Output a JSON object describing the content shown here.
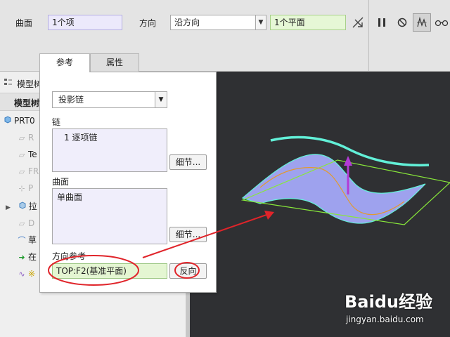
{
  "dashboard": {
    "surface_label": "曲面",
    "surface_value": "1个项",
    "direction_label": "方向",
    "direction_value": "沿方向",
    "plane_value": "1个平面",
    "icons": [
      "flip-arrow-icon",
      "pause-icon",
      "cancel-icon",
      "glasses-icon"
    ]
  },
  "tabs": [
    "参考",
    "属性"
  ],
  "tree": {
    "header1": "模型树",
    "header2": "模型树",
    "items": [
      {
        "label": "PRT0",
        "icon": "part-icon",
        "dim": false
      },
      {
        "label": "R",
        "icon": "datum-plane-icon",
        "dim": true
      },
      {
        "label": "Te",
        "icon": "datum-plane-icon",
        "dim": false
      },
      {
        "label": "FR",
        "icon": "datum-plane-icon",
        "dim": true
      },
      {
        "label": "P",
        "icon": "csys-icon",
        "dim": true
      },
      {
        "label": "拉",
        "icon": "extrude-icon",
        "dim": false
      },
      {
        "label": "D",
        "icon": "datum-plane-icon",
        "dim": true
      },
      {
        "label": "草",
        "icon": "sketch-icon",
        "dim": false
      },
      {
        "label": "在",
        "icon": "insert-arrow-icon",
        "dim": false
      },
      {
        "label": "※",
        "icon": "curve-icon",
        "dim": false
      }
    ]
  },
  "panel": {
    "chain_type": "投影链",
    "chain_label": "链",
    "chain_item": "1 逐项链",
    "detail_button": "细节...",
    "surface_label": "曲面",
    "surface_item": "单曲面",
    "direction_ref_label": "方向参考",
    "direction_ref_value": "TOP:F2(基准平面)",
    "flip_button": "反向"
  },
  "colors": {
    "viewport_bg": "#2f3033",
    "annotation_red": "#e0242a",
    "surface_fill": "#9ea2ee",
    "surface_edge": "#62f0d8",
    "plane_edge": "#88e83a",
    "curve_orange": "#e29a2e",
    "direction_arrow": "#b33bd6"
  },
  "watermark": {
    "brand": "Baidu经验",
    "url": "jingyan.baidu.com"
  }
}
